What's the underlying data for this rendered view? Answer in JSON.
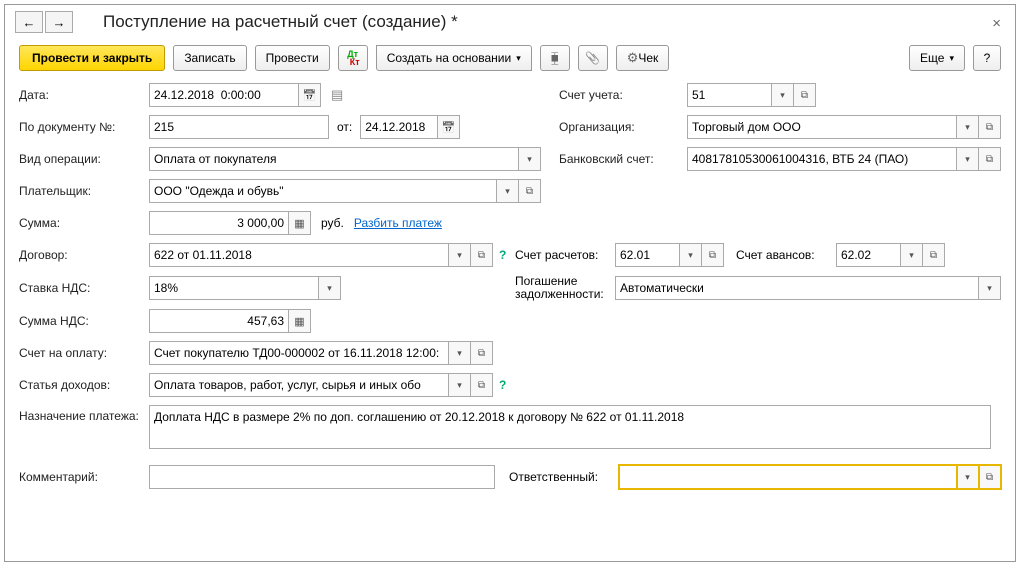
{
  "title": "Поступление на расчетный счет (создание) *",
  "toolbar": {
    "post_close": "Провести и закрыть",
    "save": "Записать",
    "post": "Провести",
    "create_based": "Создать на основании",
    "check": "Чек",
    "more": "Еще",
    "help": "?"
  },
  "labels": {
    "date": "Дата:",
    "account": "Счет учета:",
    "by_doc": "По документу №:",
    "from": "от:",
    "org": "Организация:",
    "op_type": "Вид операции:",
    "bank_acc": "Банковский счет:",
    "payer": "Плательщик:",
    "sum": "Сумма:",
    "rub": "руб.",
    "split": "Разбить платеж",
    "contract": "Договор:",
    "settle_acc": "Счет расчетов:",
    "advance_acc": "Счет авансов:",
    "vat_rate": "Ставка НДС:",
    "debt": "Погашение задолженности:",
    "vat_sum": "Сумма НДС:",
    "invoice": "Счет на оплату:",
    "income": "Статья доходов:",
    "purpose": "Назначение платежа:",
    "comment": "Комментарий:",
    "responsible": "Ответственный:"
  },
  "values": {
    "date": "24.12.2018  0:00:00",
    "account": "51",
    "doc_num": "215",
    "doc_date": "24.12.2018",
    "org": "Торговый дом ООО",
    "op_type": "Оплата от покупателя",
    "bank_acc": "40817810530061004316, ВТБ 24 (ПАО)",
    "payer": "ООО \"Одежда и обувь\"",
    "sum": "3 000,00",
    "contract": "622 от 01.11.2018",
    "settle_acc": "62.01",
    "advance_acc": "62.02",
    "vat_rate": "18%",
    "debt": "Автоматически",
    "vat_sum": "457,63",
    "invoice": "Счет покупателю ТД00-000002 от 16.11.2018 12:00:",
    "income": "Оплата товаров, работ, услуг, сырья и иных обо",
    "purpose": "Доплата НДС в размере 2% по доп. соглашению от 20.12.2018 к договору № 622 от 01.11.2018",
    "comment": "",
    "responsible": ""
  }
}
